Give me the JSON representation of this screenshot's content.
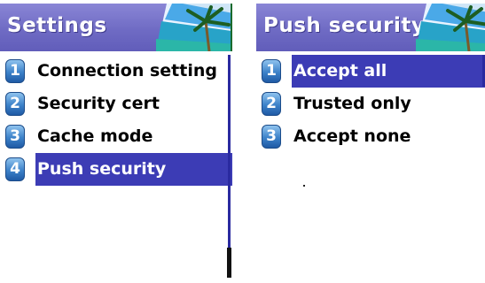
{
  "left_screen": {
    "title": "Settings",
    "items": [
      {
        "number": "1",
        "label": "Connection setting"
      },
      {
        "number": "2",
        "label": "Security cert"
      },
      {
        "number": "3",
        "label": "Cache mode"
      },
      {
        "number": "4",
        "label": "Push security",
        "selected": true
      }
    ]
  },
  "right_screen": {
    "title": "Push security",
    "items": [
      {
        "number": "1",
        "label": "Accept all",
        "selected": true
      },
      {
        "number": "2",
        "label": "Trusted only"
      },
      {
        "number": "3",
        "label": "Accept none"
      }
    ]
  },
  "colors": {
    "title_bar": "#6f6bc4",
    "selection": "#3c3cb5",
    "number_badge": "#3d82c9",
    "scrollbar": "#2a2aa0"
  },
  "icons": [
    "beach-palm-icon",
    "number-badge-icon"
  ]
}
